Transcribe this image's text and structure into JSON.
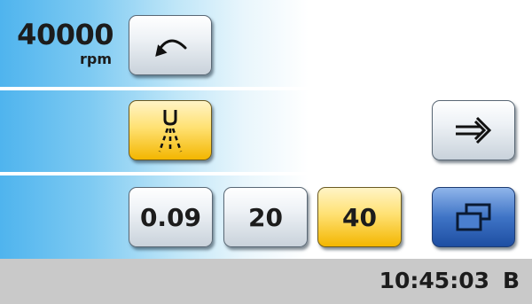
{
  "speed": {
    "value": "40000",
    "unit": "rpm"
  },
  "controls": {
    "back_icon": "rotate-back-arrow-icon",
    "spray_icon": "spray-nozzle-icon",
    "enter_icon": "arrow-into-bracket-icon",
    "windows_icon": "overlapping-windows-icon"
  },
  "value_buttons": [
    {
      "label": "0.09",
      "selected": false
    },
    {
      "label": "20",
      "selected": false
    },
    {
      "label": "40",
      "selected": true
    }
  ],
  "status": {
    "time": "10:45:03",
    "mode": "B"
  },
  "colors": {
    "sky_blue": "#4fb4ee",
    "selected_yellow": "#ffd84a",
    "button_blue": "#3f74c6",
    "status_gray": "#c9c9c9"
  }
}
